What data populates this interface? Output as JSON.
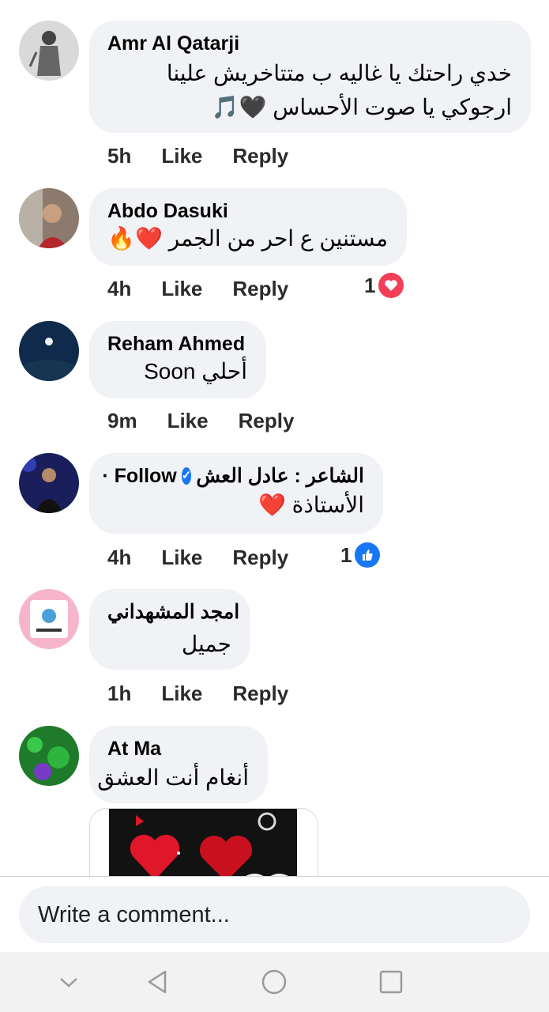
{
  "comments": [
    {
      "name": "Amr Al Qatarji",
      "line1": "خدي راحتك يا غاليه ب متتاخريش علينا",
      "line2": "ارجوكي يا صوت الأحساس",
      "line2_emoji": "🖤🎵",
      "time": "5h",
      "like": "Like",
      "reply": "Reply"
    },
    {
      "name": "Abdo Dasuki",
      "text": "مستنين ع احر من الجمر",
      "text_emoji": "❤️🔥",
      "time": "4h",
      "like": "Like",
      "reply": "Reply",
      "reaction_count": "1",
      "reaction_icon": "love-reaction-icon",
      "reaction_color": "#f33e58"
    },
    {
      "name": "Reham Ahmed",
      "text": "أحلي Soon",
      "time": "9m",
      "like": "Like",
      "reply": "Reply"
    },
    {
      "name_prefix": "الشاعر : عادل العش",
      "follow": "· Follow",
      "text": "الأستاذة",
      "text_emoji": "❤️",
      "time": "4h",
      "like": "Like",
      "reply": "Reply",
      "reaction_count": "1",
      "reaction_icon": "like-reaction-icon",
      "reaction_color": "#1877f2"
    },
    {
      "name": "امجد المشهداني",
      "text": "جميل",
      "time": "1h",
      "like": "Like",
      "reply": "Reply"
    },
    {
      "name": "At Ma",
      "text": "أنغام أنت العشق"
    }
  ],
  "composer": {
    "placeholder": "Write a comment..."
  },
  "navbar": {
    "icons": [
      "chevron-down-icon",
      "back-triangle-icon",
      "home-circle-icon",
      "recents-square-icon"
    ]
  },
  "colors": {
    "bubble": "#f0f2f5",
    "text": "#050505",
    "secondary": "#2b2b2b",
    "verified": "#1877f2"
  }
}
